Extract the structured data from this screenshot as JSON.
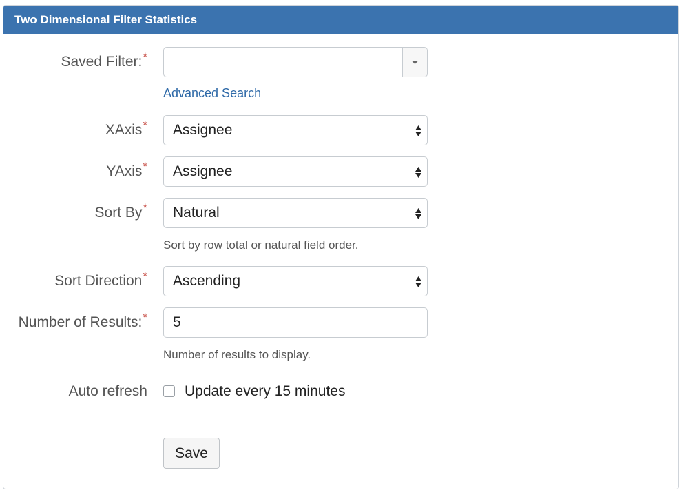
{
  "panel": {
    "title": "Two Dimensional Filter Statistics"
  },
  "required_mark": "*",
  "saved_filter": {
    "label": "Saved Filter:",
    "value": "",
    "advanced_search_link": "Advanced Search"
  },
  "xaxis": {
    "label": "XAxis",
    "value": "Assignee"
  },
  "yaxis": {
    "label": "YAxis",
    "value": "Assignee"
  },
  "sort_by": {
    "label": "Sort By",
    "value": "Natural",
    "hint": "Sort by row total or natural field order."
  },
  "sort_direction": {
    "label": "Sort Direction",
    "value": "Ascending"
  },
  "num_results": {
    "label": "Number of Results:",
    "value": "5",
    "hint": "Number of results to display."
  },
  "auto_refresh": {
    "label": "Auto refresh",
    "checkbox_label": "Update every 15 minutes",
    "checked": false
  },
  "save": {
    "label": "Save"
  }
}
